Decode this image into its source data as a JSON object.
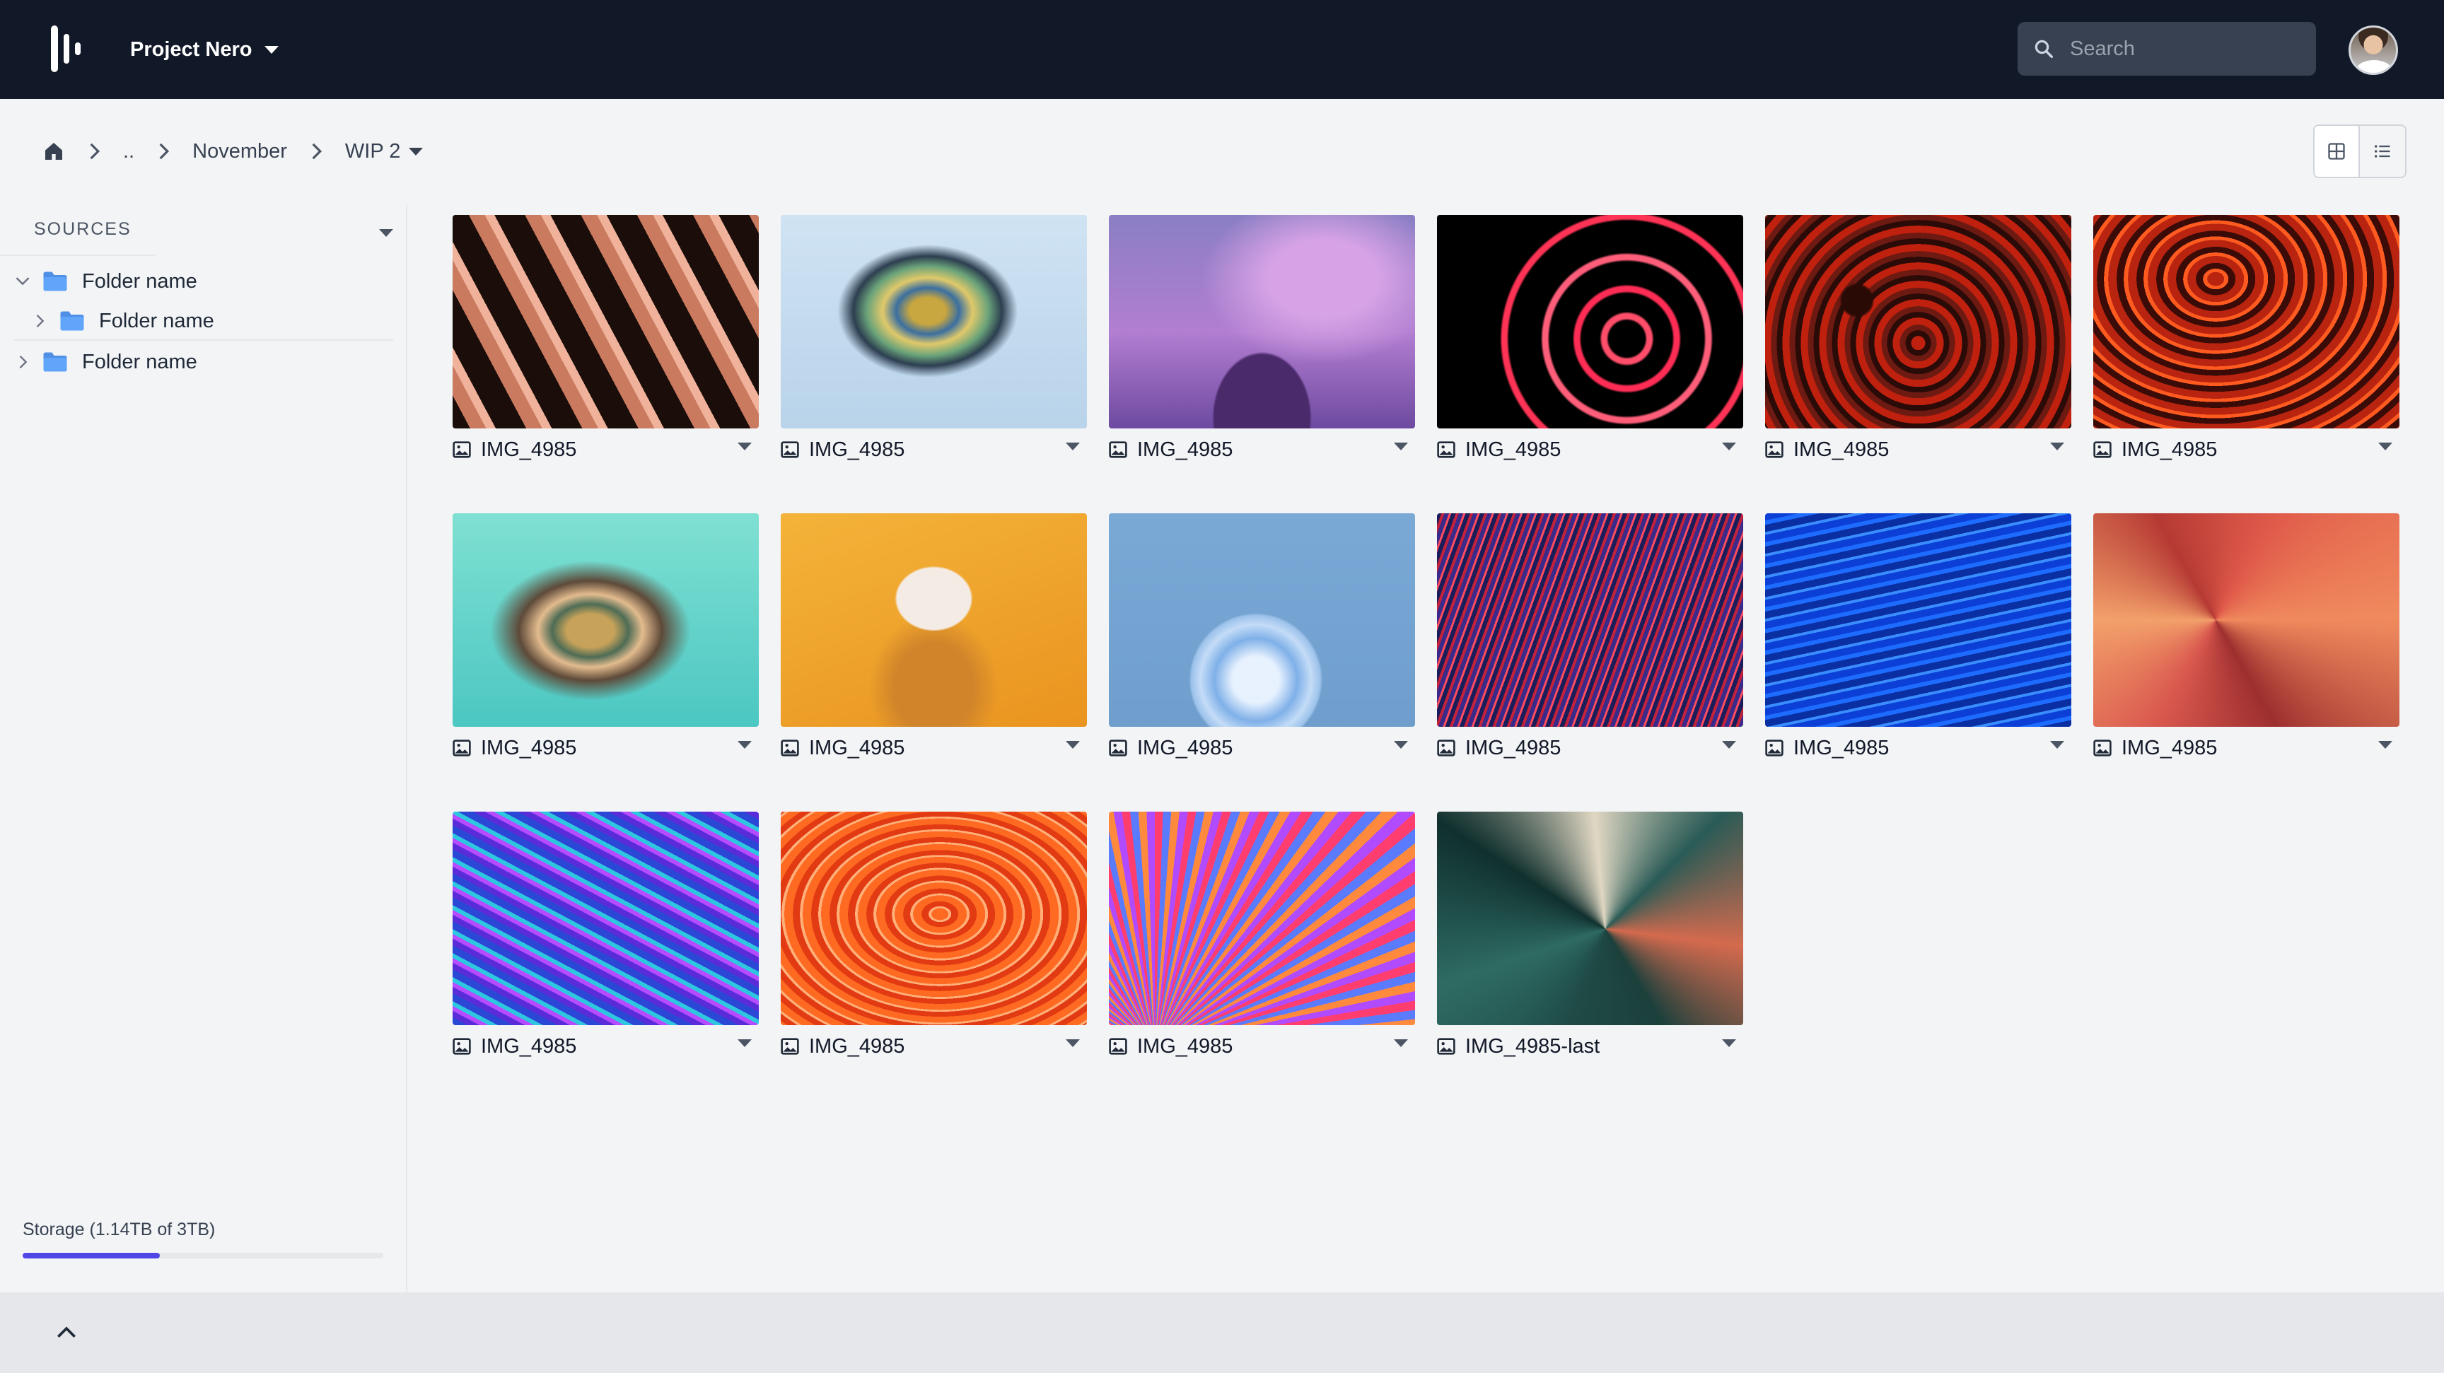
{
  "header": {
    "project_name": "Project Nero",
    "search_placeholder": "Search"
  },
  "breadcrumb": {
    "parent": "..",
    "month": "November",
    "current": "WIP 2"
  },
  "sidebar": {
    "sources_label": "SOURCES",
    "folders": [
      {
        "label": "Folder name",
        "expanded": true
      },
      {
        "label": "Folder name",
        "expanded": false
      },
      {
        "label": "Folder name",
        "expanded": false
      }
    ],
    "storage_label": "Storage (1.14TB of 3TB)",
    "storage_used_fraction": 0.38
  },
  "images": [
    {
      "name": "IMG_4985"
    },
    {
      "name": "IMG_4985"
    },
    {
      "name": "IMG_4985"
    },
    {
      "name": "IMG_4985"
    },
    {
      "name": "IMG_4985"
    },
    {
      "name": "IMG_4985"
    },
    {
      "name": "IMG_4985"
    },
    {
      "name": "IMG_4985"
    },
    {
      "name": "IMG_4985"
    },
    {
      "name": "IMG_4985"
    },
    {
      "name": "IMG_4985"
    },
    {
      "name": "IMG_4985"
    },
    {
      "name": "IMG_4985"
    },
    {
      "name": "IMG_4985"
    },
    {
      "name": "IMG_4985"
    },
    {
      "name": "IMG_4985-last"
    }
  ],
  "colors": {
    "topbar": "#111827",
    "accent": "#4f46e5",
    "folder": "#4f8fe6"
  }
}
